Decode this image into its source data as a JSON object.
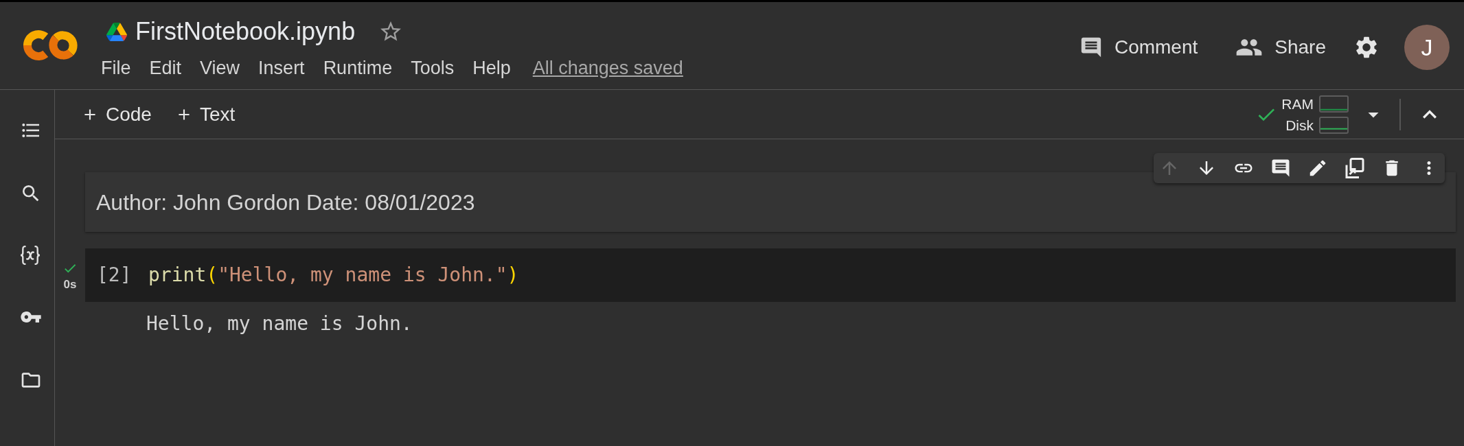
{
  "header": {
    "title": "FirstNotebook.ipynb",
    "starred": false,
    "menu": [
      "File",
      "Edit",
      "View",
      "Insert",
      "Runtime",
      "Tools",
      "Help"
    ],
    "save_status": "All changes saved",
    "actions": [
      "Comment",
      "Share"
    ],
    "avatar_initial": "J"
  },
  "toolbar": {
    "insert_buttons": [
      "Code",
      "Text"
    ],
    "connected": true,
    "resources": [
      {
        "label": "RAM"
      },
      {
        "label": "Disk"
      }
    ]
  },
  "cells": [
    {
      "kind": "markdown",
      "text": "Author: John Gordon Date: 08/01/2023",
      "toolbar": [
        {
          "disabled": true
        },
        {
          "disabled": false
        },
        {
          "disabled": false
        },
        {
          "disabled": false
        },
        {
          "disabled": false
        },
        {
          "disabled": false
        },
        {
          "disabled": false
        },
        {
          "disabled": false
        }
      ]
    },
    {
      "kind": "code",
      "execution_count": "[2]",
      "ran": true,
      "duration": "0s",
      "code": [
        {
          "kind": "function",
          "text": "print"
        },
        {
          "kind": "bracket",
          "text": "("
        },
        {
          "kind": "string",
          "text": "\"Hello, my name is John.\""
        },
        {
          "kind": "bracket",
          "text": ")"
        }
      ],
      "output": "Hello, my name is John."
    }
  ]
}
